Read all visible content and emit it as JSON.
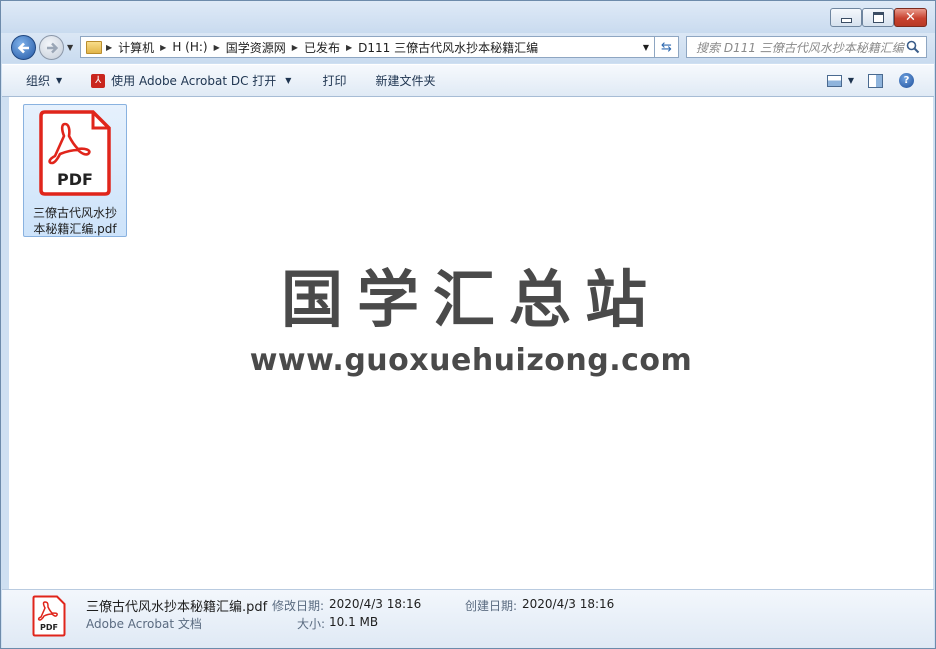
{
  "titlebar": {
    "minimize_icon": "minimize-icon",
    "maximize_icon": "maximize-icon",
    "close_icon": "close-icon"
  },
  "address": {
    "crumbs": [
      "计算机",
      "H (H:)",
      "国学资源网",
      "已发布",
      "D111 三僚古代风水抄本秘籍汇编"
    ],
    "search_placeholder": "搜索 D111 三僚古代风水抄本秘籍汇编"
  },
  "toolbar": {
    "organize": "组织",
    "open_with": "使用 Adobe Acrobat DC 打开",
    "print": "打印",
    "new_folder": "新建文件夹"
  },
  "file": {
    "name_line1": "三僚古代风水抄",
    "name_line2": "本秘籍汇编.pdf",
    "icon_label": "PDF"
  },
  "watermark": {
    "cn": "国学汇总站",
    "url": "www.guoxuehuizong.com"
  },
  "details": {
    "filename": "三僚古代风水抄本秘籍汇编.pdf",
    "type": "Adobe Acrobat 文档",
    "modified_label": "修改日期:",
    "modified_value": "2020/4/3 18:16",
    "created_label": "创建日期:",
    "created_value": "2020/4/3 18:16",
    "size_label": "大小:",
    "size_value": "10.1 MB",
    "icon_label": "PDF"
  },
  "colors": {
    "pdf_red": "#e0251b",
    "selection": "#cde3fa",
    "accent": "#2f6ab0"
  }
}
